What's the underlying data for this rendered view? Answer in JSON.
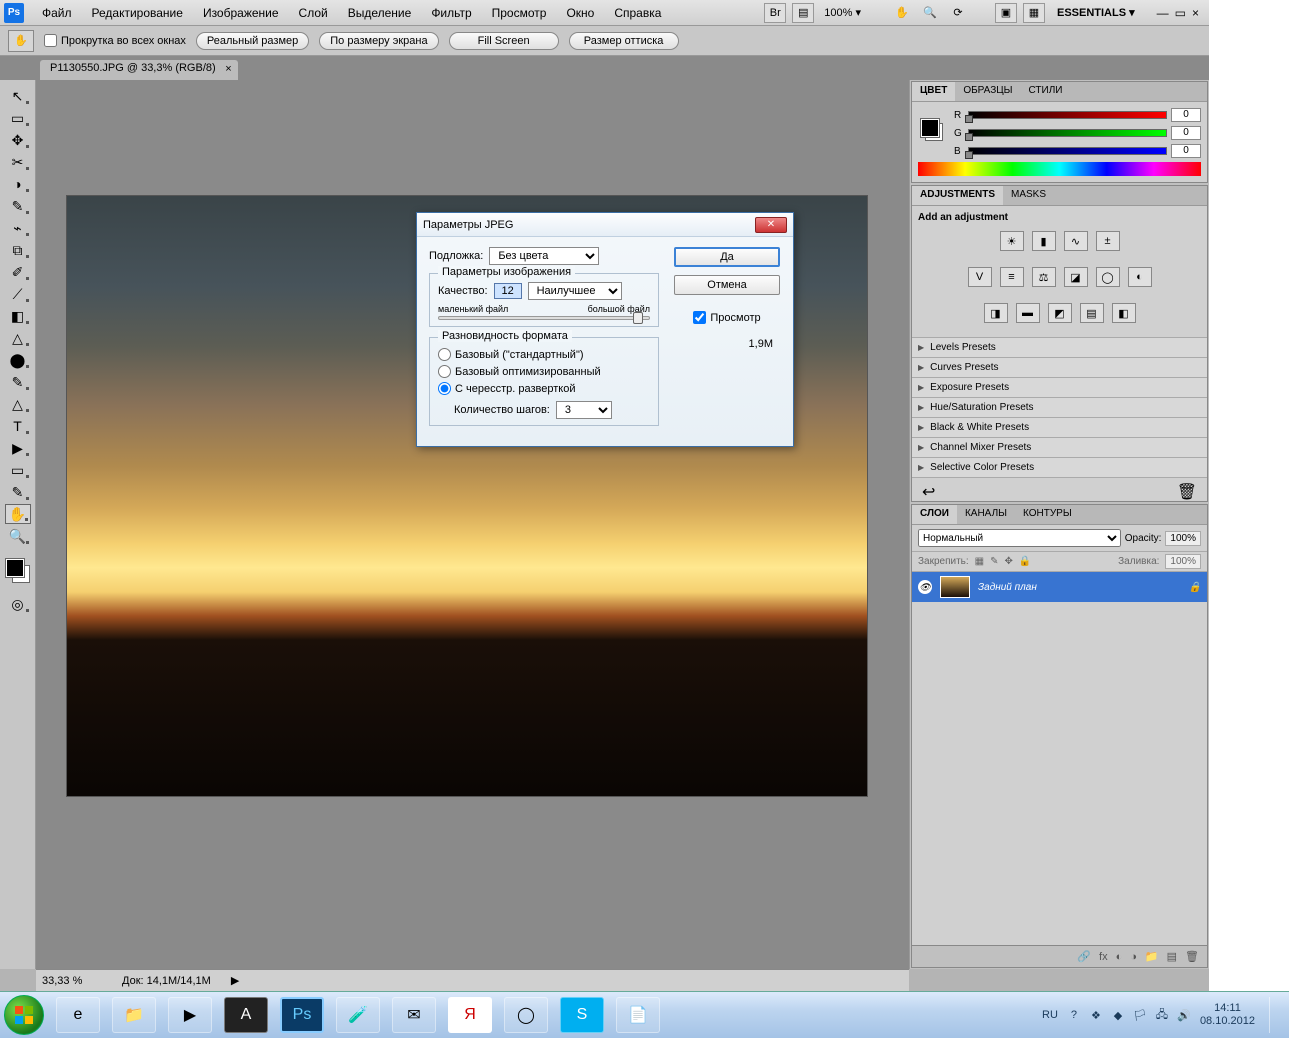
{
  "menu": {
    "items": [
      "Файл",
      "Редактирование",
      "Изображение",
      "Слой",
      "Выделение",
      "Фильтр",
      "Просмотр",
      "Окно",
      "Справка"
    ],
    "zoom": "100% ▾",
    "essentials": "ESSENTIALS ▾"
  },
  "options": {
    "checkbox_label": "Прокрутка во всех окнах",
    "buttons": [
      "Реальный размер",
      "По размеру экрана",
      "Fill Screen",
      "Размер оттиска"
    ]
  },
  "doc_tab": {
    "title": "P1130550.JPG @ 33,3% (RGB/8)",
    "close": "×"
  },
  "tools": [
    "↖",
    "▭",
    "✥",
    "✂",
    "◑",
    "✎",
    "⌁",
    "⧉",
    "✐",
    "⟋",
    "◧",
    "△",
    "⬤",
    "✎",
    "△",
    "T",
    "▶",
    "✋",
    "🔍"
  ],
  "color_panel": {
    "tabs": [
      "ЦВЕТ",
      "ОБРАЗЦЫ",
      "СТИЛИ"
    ],
    "r": "0",
    "g": "0",
    "b": "0"
  },
  "adjustments": {
    "tabs": [
      "ADJUSTMENTS",
      "MASKS"
    ],
    "hint": "Add an adjustment",
    "presets": [
      "Levels Presets",
      "Curves Presets",
      "Exposure Presets",
      "Hue/Saturation Presets",
      "Black & White Presets",
      "Channel Mixer Presets",
      "Selective Color Presets"
    ]
  },
  "layers": {
    "tabs": [
      "СЛОИ",
      "КАНАЛЫ",
      "КОНТУРЫ"
    ],
    "blend": "Нормальный",
    "opacity_label": "Opacity:",
    "opacity": "100%",
    "lock_label": "Закрепить:",
    "fill_label": "Заливка:",
    "fill": "100%",
    "layer_name": "Задний план"
  },
  "status": {
    "zoom": "33,33 %",
    "doc": "Док: 14,1M/14,1M"
  },
  "dialog": {
    "title": "Параметры JPEG",
    "matte_label": "Подложка:",
    "matte_value": "Без цвета",
    "group_image": "Параметры изображения",
    "quality_label": "Качество:",
    "quality_value": "12",
    "quality_preset": "Наилучшее",
    "slider_small": "маленький файл",
    "slider_big": "большой файл",
    "group_format": "Разновидность формата",
    "radio1": "Базовый (\"стандартный\")",
    "radio2": "Базовый оптимизированный",
    "radio3": "С чересстр. разверткой",
    "steps_label": "Количество шагов:",
    "steps_value": "3",
    "ok": "Да",
    "cancel": "Отмена",
    "preview": "Просмотр",
    "filesize": "1,9M"
  },
  "taskbar": {
    "lang": "RU",
    "time": "14:11",
    "date": "08.10.2012"
  }
}
